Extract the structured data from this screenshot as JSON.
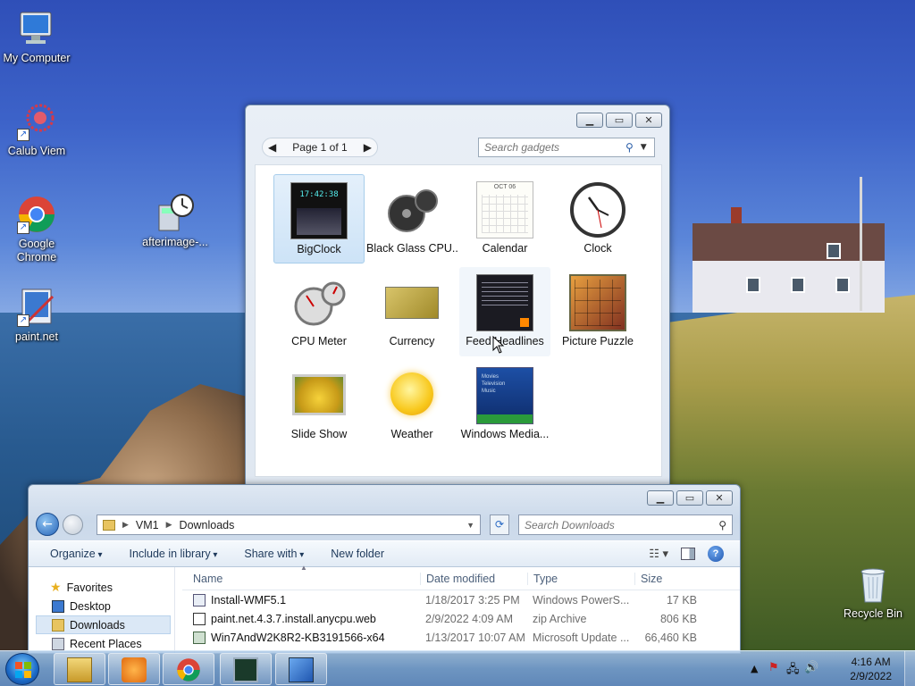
{
  "desktop": {
    "icons": [
      {
        "label": "My Computer"
      },
      {
        "label": "Calub Viem"
      },
      {
        "label": "Google Chrome"
      },
      {
        "label": "afterimage-..."
      },
      {
        "label": "paint.net"
      },
      {
        "label": "Recycle Bin"
      }
    ]
  },
  "gadgets_window": {
    "pager_label": "Page 1 of 1",
    "search_placeholder": "Search gadgets",
    "items": [
      {
        "label": "BigClock",
        "clock_text": "17:42:38"
      },
      {
        "label": "Black Glass CPU..."
      },
      {
        "label": "Calendar",
        "month": "OCT 06"
      },
      {
        "label": "Clock"
      },
      {
        "label": "CPU Meter"
      },
      {
        "label": "Currency"
      },
      {
        "label": "Feed Headlines"
      },
      {
        "label": "Picture Puzzle"
      },
      {
        "label": "Slide Show"
      },
      {
        "label": "Weather"
      },
      {
        "label": "Windows Media...",
        "menu": [
          "Movies",
          "Television",
          "Music"
        ]
      }
    ]
  },
  "explorer": {
    "address": [
      "VM1",
      "Downloads"
    ],
    "search_placeholder": "Search Downloads",
    "toolbar": {
      "organize": "Organize",
      "include": "Include in library",
      "share": "Share with",
      "new_folder": "New folder"
    },
    "nav": {
      "favorites": "Favorites",
      "items": [
        "Desktop",
        "Downloads",
        "Recent Places"
      ]
    },
    "columns": {
      "name": "Name",
      "date": "Date modified",
      "type": "Type",
      "size": "Size"
    },
    "files": [
      {
        "name": "Install-WMF5.1",
        "date": "1/18/2017 3:25 PM",
        "type": "Windows PowerS...",
        "size": "17 KB"
      },
      {
        "name": "paint.net.4.3.7.install.anycpu.web",
        "date": "2/9/2022 4:09 AM",
        "type": "zip Archive",
        "size": "806 KB"
      },
      {
        "name": "Win7AndW2K8R2-KB3191566-x64",
        "date": "1/13/2017 10:07 AM",
        "type": "Microsoft Update ...",
        "size": "66,460 KB"
      }
    ]
  },
  "taskbar": {
    "time": "4:16 AM",
    "date": "2/9/2022"
  },
  "colors": {
    "accent": "#1c6ac7",
    "selection": "#cde3f7"
  }
}
